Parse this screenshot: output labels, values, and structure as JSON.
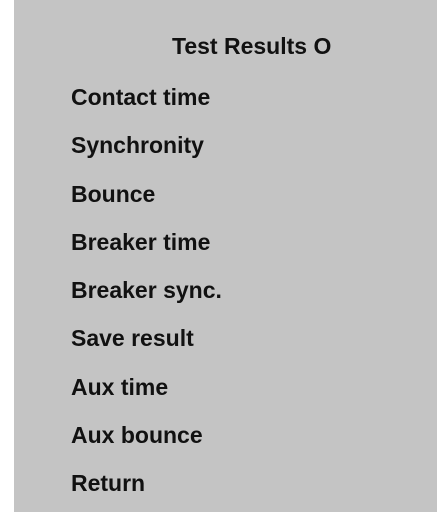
{
  "screen": {
    "title": "Test Results O",
    "menu": [
      {
        "label": "Contact time"
      },
      {
        "label": "Synchronity"
      },
      {
        "label": "Bounce"
      },
      {
        "label": "Breaker time"
      },
      {
        "label": "Breaker sync."
      },
      {
        "label": "Save result"
      },
      {
        "label": "Aux time"
      },
      {
        "label": "Aux bounce"
      },
      {
        "label": "Return"
      }
    ]
  },
  "colors": {
    "panel_background": "#c4c4c4",
    "text": "#111111",
    "page_background": "#ffffff"
  }
}
